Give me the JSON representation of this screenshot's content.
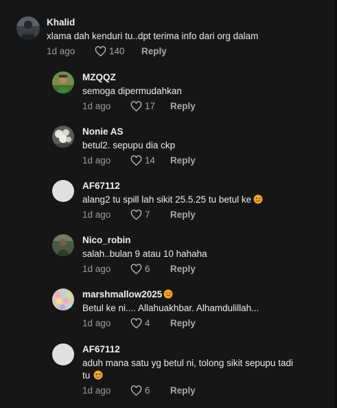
{
  "comments": [
    {
      "username": "Khalid",
      "text": "xlama dah kenduri tu..dpt terima info dari org dalam",
      "time": "1d ago",
      "likes": "140",
      "reply": "Reply",
      "avatar_icon": "dark-photo-avatar-icon"
    },
    {
      "username": "MZQQZ",
      "text": "semoga dipermudahkan",
      "time": "1d ago",
      "likes": "17",
      "reply": "Reply",
      "avatar_icon": "green-photo-avatar-icon"
    },
    {
      "username": "Nonie AS",
      "text": "betul2. sepupu dia ckp",
      "time": "1d ago",
      "likes": "14",
      "reply": "Reply",
      "avatar_icon": "flower-photo-avatar-icon"
    },
    {
      "username": "AF67112",
      "text": "alang2 tu spill lah sikit 25.5.25 tu betul ke",
      "emoji": "smirk-emoji-icon",
      "time": "1d ago",
      "likes": "7",
      "reply": "Reply",
      "avatar_icon": "default-avatar-icon"
    },
    {
      "username": "Nico_robin",
      "text": "salah..bulan 9 atau 10 hahaha",
      "time": "1d ago",
      "likes": "6",
      "reply": "Reply",
      "avatar_icon": "outdoor-photo-avatar-icon"
    },
    {
      "username": "marshmallow2025",
      "username_emoji": "woozy-emoji-icon",
      "text": "Betul ke ni.... Allahuakhbar. Alhamdulillah...",
      "time": "1d ago",
      "likes": "4",
      "reply": "Reply",
      "avatar_icon": "candy-photo-avatar-icon"
    },
    {
      "username": "AF67112",
      "text_line1": "aduh mana satu yg betul ni, tolong sikit sepupu tadi",
      "text_line2": "tu",
      "emoji": "laughing-emoji-icon",
      "time": "1d ago",
      "likes": "6",
      "reply": "Reply",
      "avatar_icon": "default-avatar-icon"
    }
  ],
  "colors": {
    "background": "#161616",
    "username": "#f1f1f1",
    "text": "#ececec",
    "meta": "#9b9b9b"
  }
}
